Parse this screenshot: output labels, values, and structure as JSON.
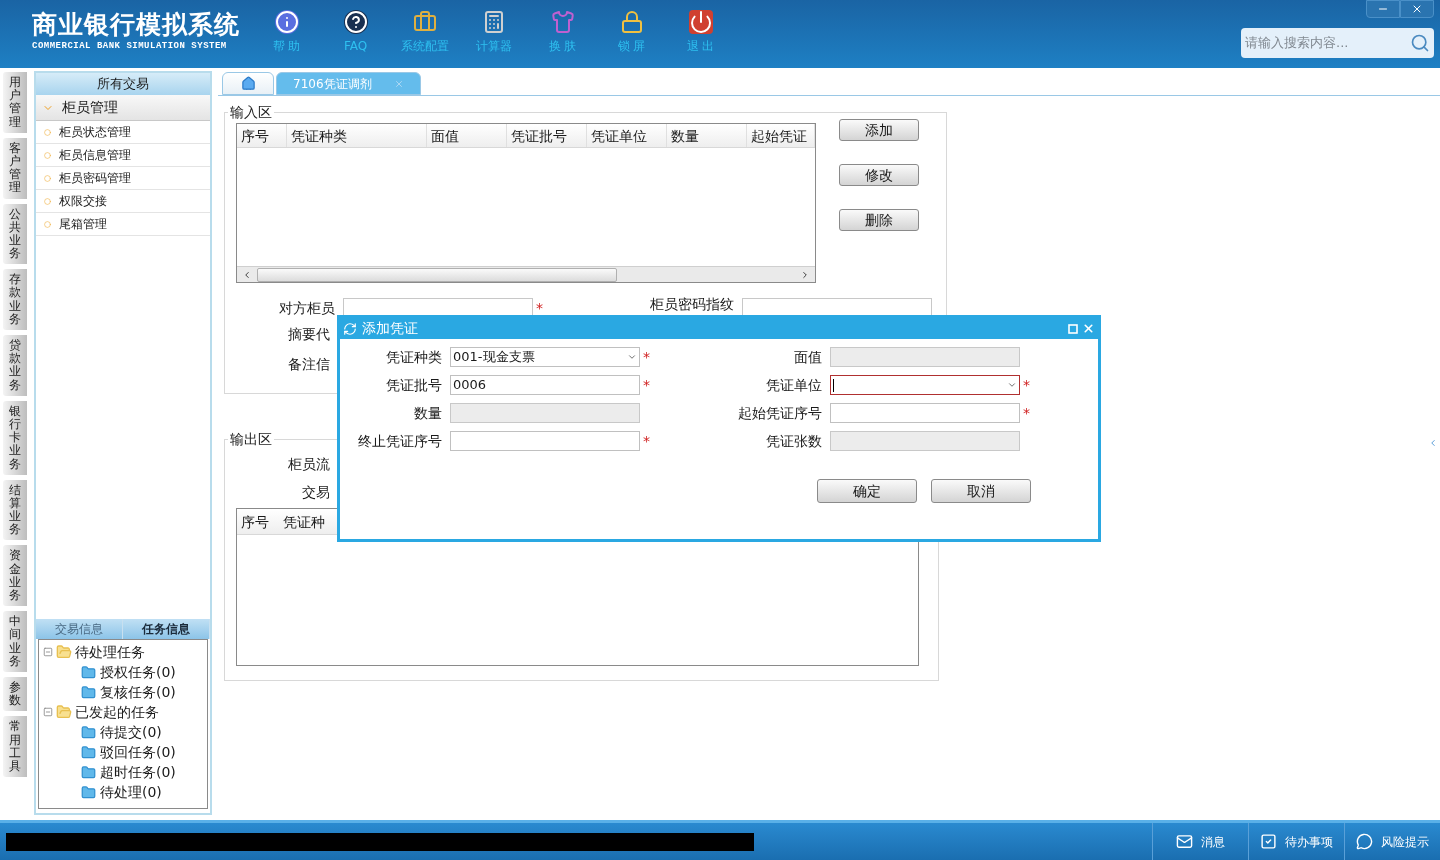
{
  "header": {
    "title": "商业银行模拟系统",
    "subtitle": "COMMERCIAL BANK SIMULATION SYSTEM",
    "toolbar": [
      {
        "kind": "info",
        "label": "帮 助"
      },
      {
        "kind": "faq",
        "label": "FAQ"
      },
      {
        "kind": "config",
        "label": "系统配置"
      },
      {
        "kind": "calculator",
        "label": "计算器"
      },
      {
        "kind": "skin",
        "label": "换 肤"
      },
      {
        "kind": "lock",
        "label": "锁 屏"
      },
      {
        "kind": "exit",
        "label": "退 出"
      }
    ],
    "search": {
      "placeholder": "请输入搜索内容..."
    }
  },
  "side_tabs": [
    "用户管理",
    "客户管理",
    "公共业务",
    "存款业务",
    "贷款业务",
    "银行卡业务",
    "结算业务",
    "资金业务",
    "中间业务",
    "参数",
    "常用工具"
  ],
  "sidebar": {
    "title": "所有交易",
    "groups": [
      {
        "label": "柜员管理",
        "expanded": true,
        "children": [
          {
            "label": "柜员状态管理"
          },
          {
            "label": "柜员信息管理"
          },
          {
            "label": "柜员密码管理"
          },
          {
            "label": "权限交接"
          },
          {
            "label": "尾箱管理"
          }
        ]
      }
    ],
    "panel_tabs": [
      {
        "label": "交易信息",
        "selected": false
      },
      {
        "label": "任务信息",
        "selected": true
      }
    ],
    "tree": [
      {
        "label": "待处理任务",
        "expanded": true,
        "children": [
          {
            "label": "授权任务(0)"
          },
          {
            "label": "复核任务(0)"
          }
        ]
      },
      {
        "label": "已发起的任务",
        "expanded": true,
        "children": [
          {
            "label": "待提交(0)"
          },
          {
            "label": "驳回任务(0)"
          },
          {
            "label": "超时任务(0)"
          },
          {
            "label": "待处理(0)"
          }
        ]
      }
    ]
  },
  "tabs": [
    {
      "kind": "home",
      "selected": false
    },
    {
      "kind": "page",
      "label": "7106凭证调剂",
      "selected": true
    }
  ],
  "input_area": {
    "legend": "输入区",
    "columns": [
      "序号",
      "凭证种类",
      "面值",
      "凭证批号",
      "凭证单位",
      "数量",
      "起始凭证"
    ],
    "buttons": [
      "添加",
      "修改",
      "删除"
    ],
    "form": [
      {
        "kind": "input",
        "label": "对方柜员",
        "mark": "*"
      },
      {
        "kind": "input",
        "label": "柜员密码指纹"
      },
      {
        "kind": "label",
        "label": "摘要代"
      },
      {
        "kind": "label",
        "label": "备注信"
      }
    ]
  },
  "output_area": {
    "legend": "输出区",
    "form": [
      "柜员流",
      "交易"
    ],
    "columns": [
      "序号",
      "凭证种"
    ]
  },
  "dialog": {
    "title": "添加凭证",
    "fields": [
      {
        "kind": "select",
        "label": "凭证种类",
        "value": "001-现金支票",
        "mark": "*"
      },
      {
        "kind": "readonly",
        "label": "面值"
      },
      {
        "kind": "text",
        "label": "凭证批号",
        "value": "0006",
        "mark": "*"
      },
      {
        "kind": "select",
        "label": "凭证单位",
        "mark": "*",
        "focused": true
      },
      {
        "kind": "readonly",
        "label": "数量"
      },
      {
        "kind": "text",
        "label": "起始凭证序号",
        "mark": "*"
      },
      {
        "kind": "text",
        "label": "终止凭证序号",
        "mark": "*"
      },
      {
        "kind": "readonly",
        "label": "凭证张数"
      }
    ],
    "buttons": [
      "确定",
      "取消"
    ]
  },
  "status_bar": [
    {
      "kind": "message",
      "label": "消息"
    },
    {
      "kind": "todo",
      "label": "待办事项"
    },
    {
      "kind": "risk",
      "label": "风险提示"
    }
  ]
}
